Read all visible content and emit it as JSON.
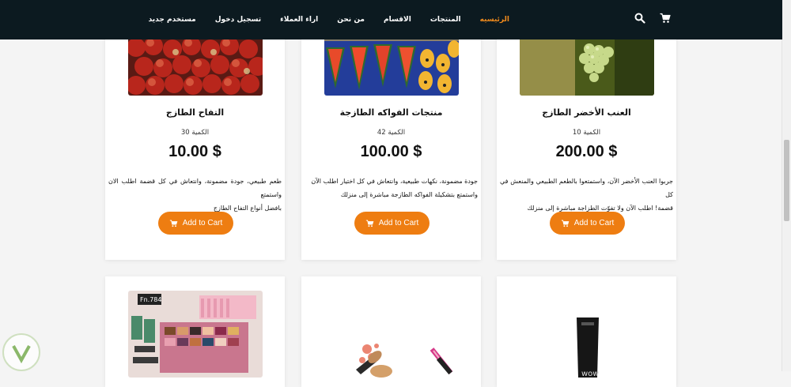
{
  "nav": {
    "links": [
      "الرئيسيه",
      "المنتجات",
      "الاقسام",
      "من نحن",
      "اراء العملاء",
      "تسجيل دخول",
      "مستخدم جديد"
    ],
    "active_color": "#f08a1c",
    "bar_color": "#0c1a20",
    "icons": [
      "search-icon",
      "cart-icon"
    ]
  },
  "products": [
    {
      "title": "التفاح الطازج",
      "qty": "الكمية 30",
      "price": "10.00 $",
      "desc": "طعم طبيعي، جودة مضمونة، وانتعاش في كل قضمة اطلب الان واستمتع\nبافضل أنواع التفاح الطازج",
      "button": "Add to Cart"
    },
    {
      "title": "منتجات الفواكه الطازجة",
      "qty": "الكمية 42",
      "price": "100.00 $",
      "desc": "جودة مضمونة، نكهات طبيعية، وانتعاش في كل اختيار اطلب الآن\nواستمتع بتشكيلة الفواكه الطازجة مباشرة إلى منزلك",
      "button": "Add to Cart"
    },
    {
      "title": "العنب الأخضر الطازج",
      "qty": "الكمية 10",
      "price": "200.00 $",
      "desc": "جربوا العنب الأخضر الآن، واستمتعوا بالطعم الطبيعي والمنعش في كل\nقضمة! اطلب الآن ولا تفوّت الطزاجة مباشرة إلى منزلك",
      "button": "Add to Cart"
    }
  ],
  "bottom_cards": [
    {
      "image": "cosmetics-kit-image",
      "badge": "Fn.784"
    },
    {
      "image": "makeup-brushes-image"
    },
    {
      "image": "skincare-tube-image",
      "tube_text": "wow"
    }
  ],
  "accent": "#ee7d11"
}
